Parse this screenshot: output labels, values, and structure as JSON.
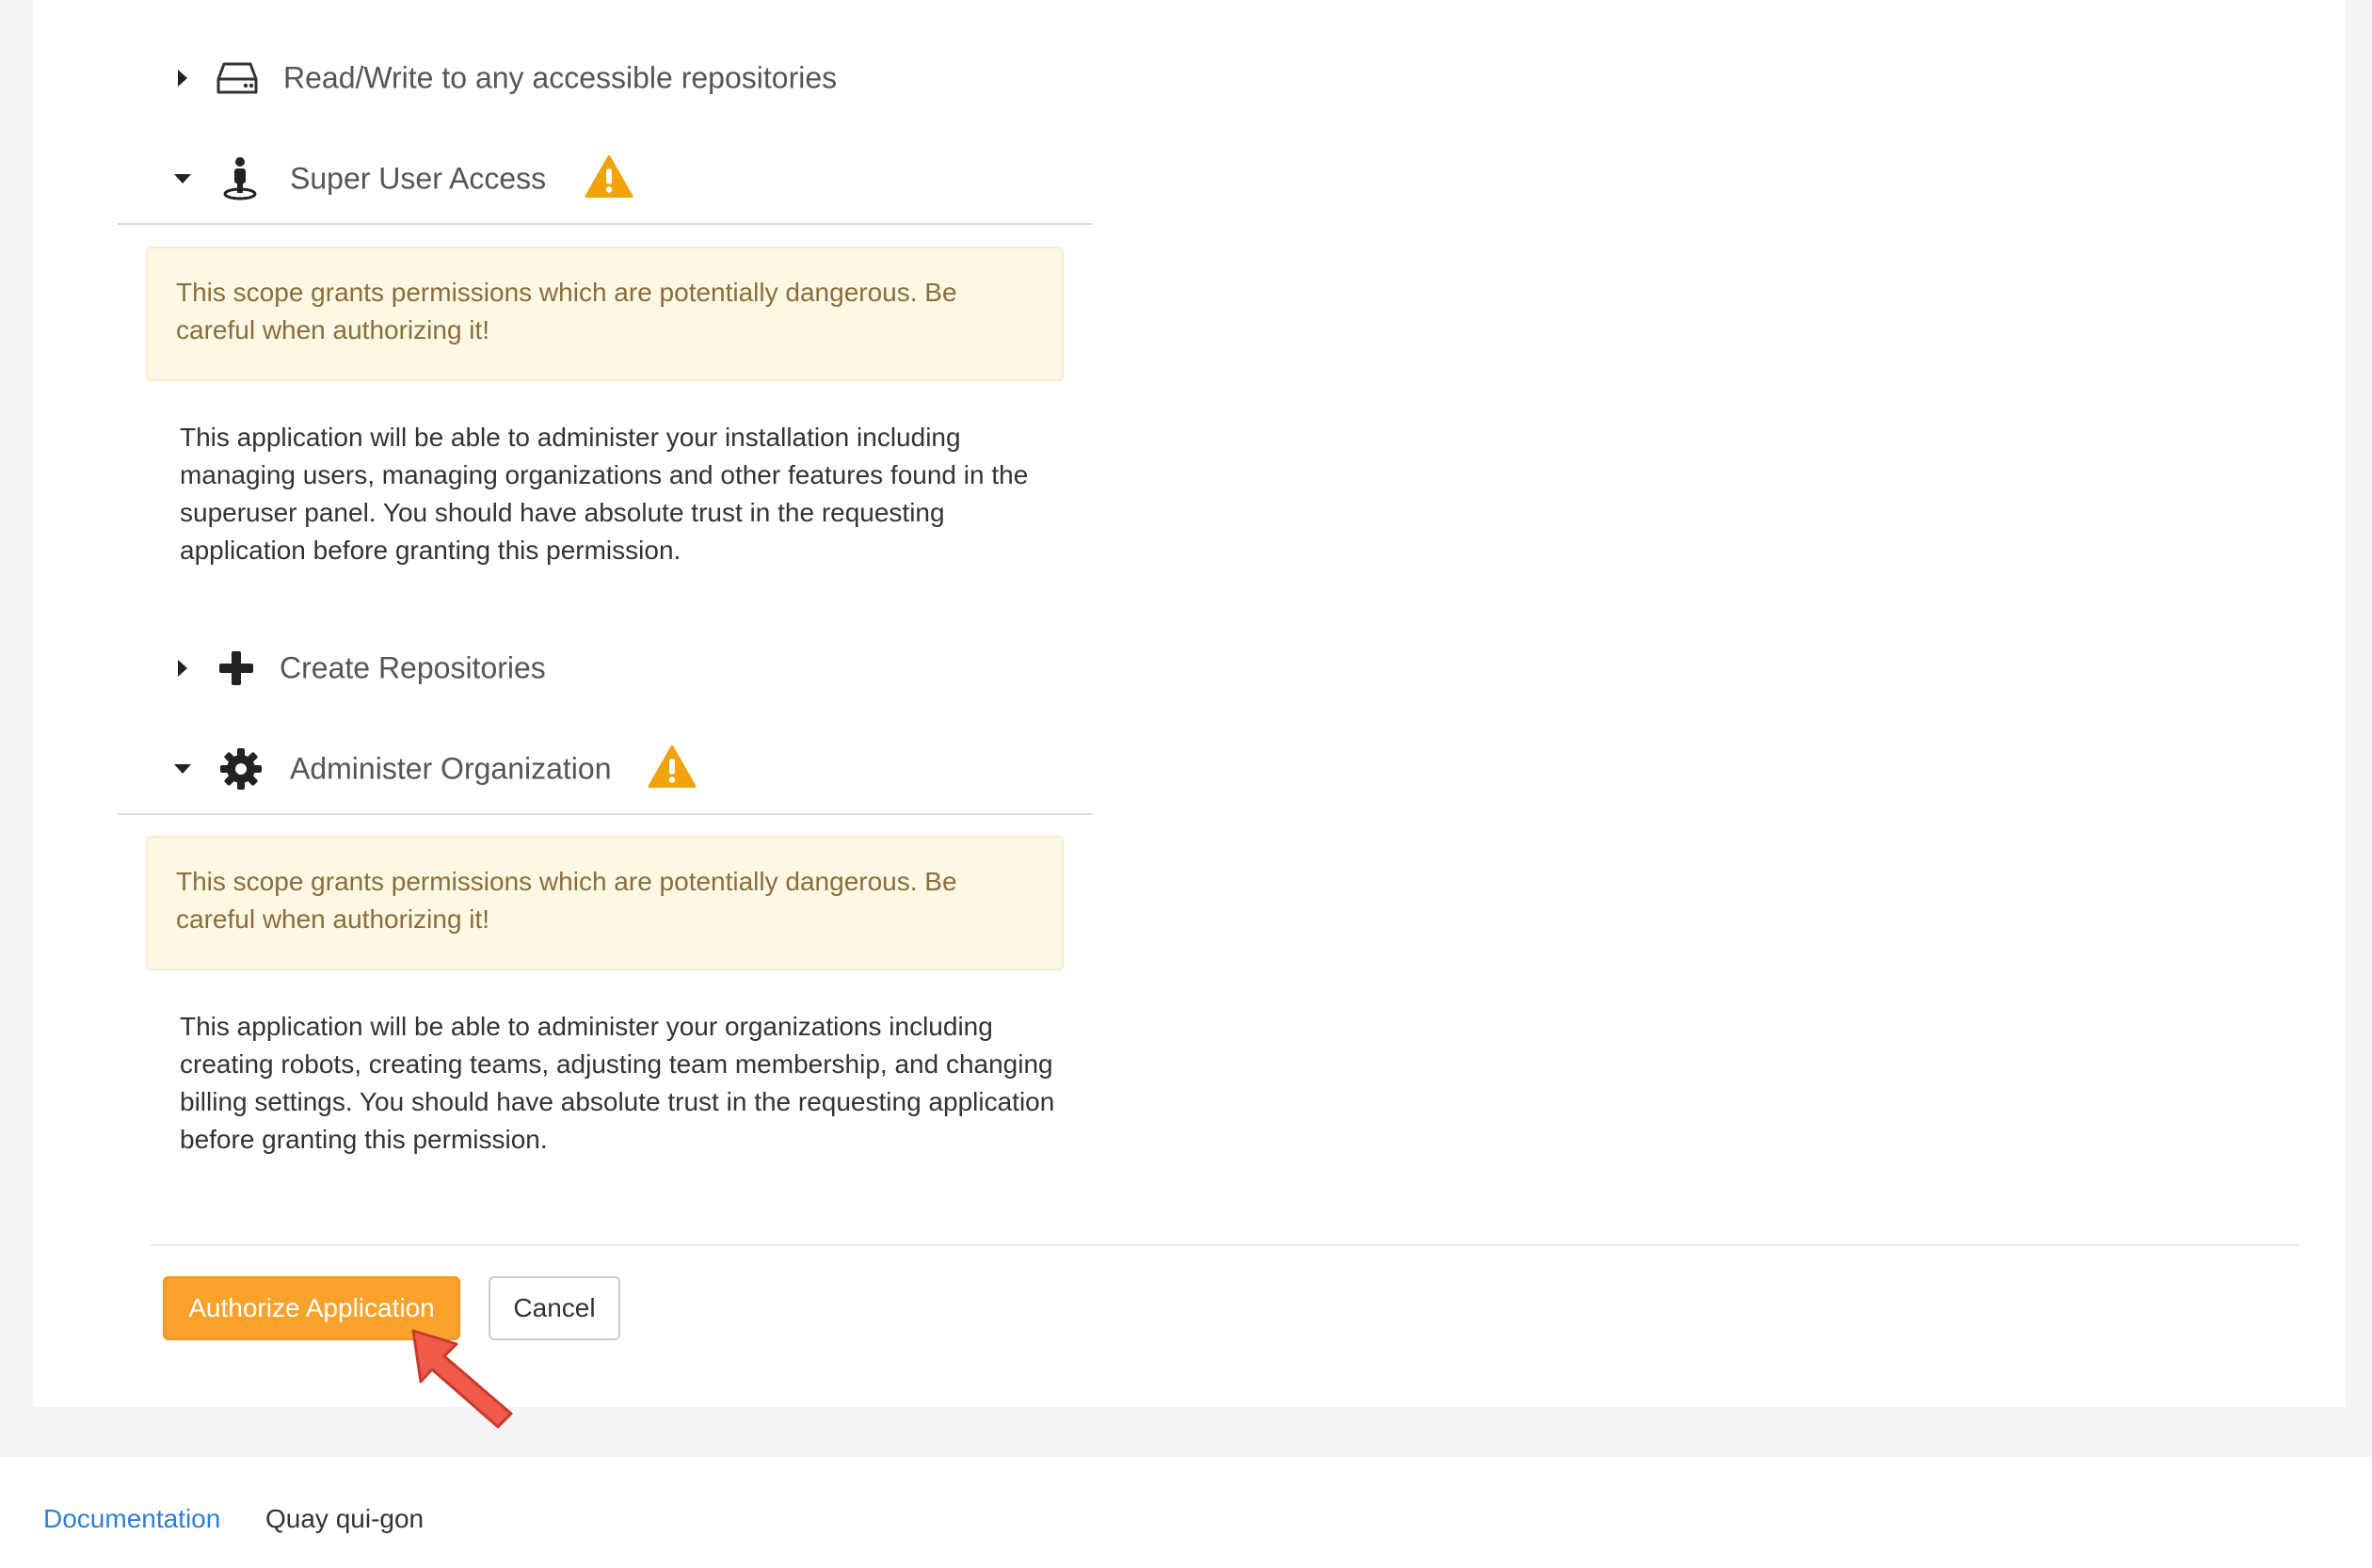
{
  "scopes": [
    {
      "title": "Read/Write to any accessible repositories",
      "icon": "hard-drive-icon",
      "expanded": false
    },
    {
      "title": "Super User Access",
      "icon": "user-pin-icon",
      "expanded": true,
      "warning": "This scope grants permissions which are potentially dangerous. Be careful when authorizing it!",
      "description": "This application will be able to administer your installation including managing users, managing organizations and other features found in the superuser panel. You should have absolute trust in the requesting application before granting this permission."
    },
    {
      "title": "Create Repositories",
      "icon": "plus-icon",
      "expanded": false
    },
    {
      "title": "Administer Organization",
      "icon": "gear-icon",
      "expanded": true,
      "warning": "This scope grants permissions which are potentially dangerous. Be careful when authorizing it!",
      "description": "This application will be able to administer your organizations including creating robots, creating teams, adjusting team membership, and changing billing settings. You should have absolute trust in the requesting application before granting this permission."
    }
  ],
  "actions": {
    "authorize_label": "Authorize Application",
    "cancel_label": "Cancel"
  },
  "footer": {
    "documentation_label": "Documentation",
    "version_label": "Quay qui-gon"
  },
  "colors": {
    "primary": "#f9a22b",
    "warning_text": "#8a6d3b",
    "warning_bg": "#fcf8e3",
    "warning_icon": "#f0a30a",
    "link": "#2f7ed8",
    "annotation_arrow": "#f05a4a"
  }
}
